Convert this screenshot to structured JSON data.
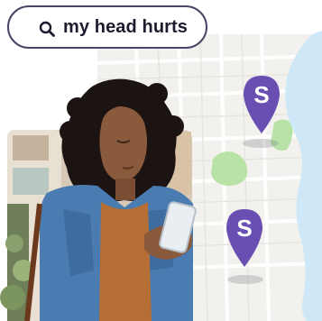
{
  "search": {
    "query": "my head hurts",
    "icon": "search-icon"
  },
  "map": {
    "pin_letter": "S",
    "pin_color": "#6a4fb3",
    "water_color": "#cfe8f7",
    "park_color": "#b9e2a6"
  },
  "photo": {
    "subject": "woman-looking-at-phone"
  }
}
